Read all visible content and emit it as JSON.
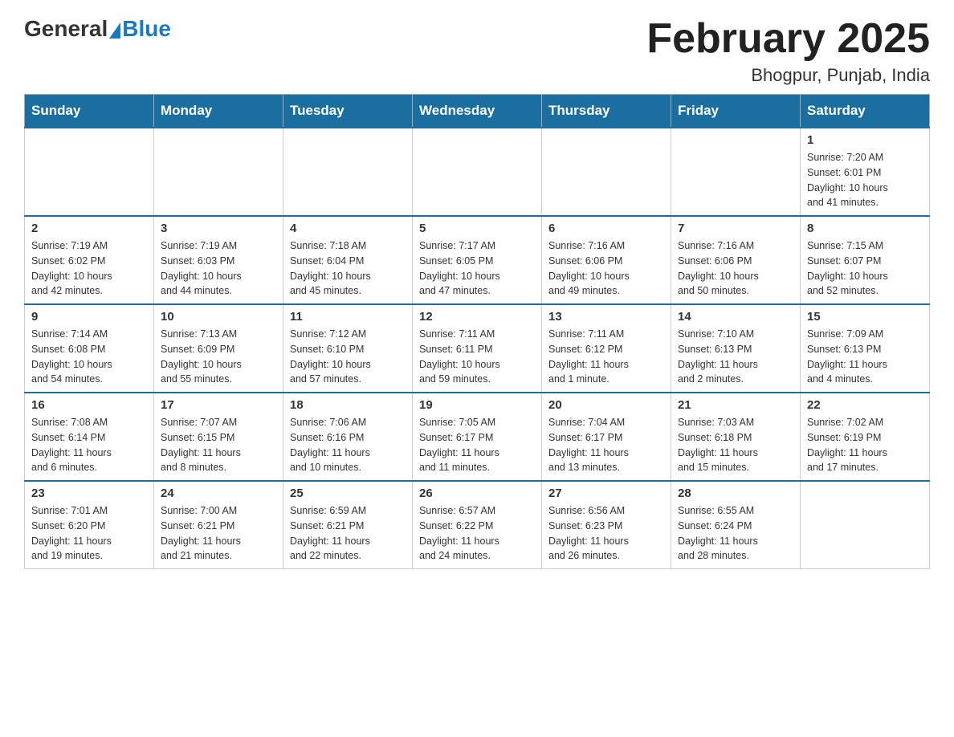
{
  "header": {
    "logo_general": "General",
    "logo_blue": "Blue",
    "month_title": "February 2025",
    "location": "Bhogpur, Punjab, India"
  },
  "weekdays": [
    "Sunday",
    "Monday",
    "Tuesday",
    "Wednesday",
    "Thursday",
    "Friday",
    "Saturday"
  ],
  "weeks": [
    [
      {
        "day": "",
        "info": ""
      },
      {
        "day": "",
        "info": ""
      },
      {
        "day": "",
        "info": ""
      },
      {
        "day": "",
        "info": ""
      },
      {
        "day": "",
        "info": ""
      },
      {
        "day": "",
        "info": ""
      },
      {
        "day": "1",
        "info": "Sunrise: 7:20 AM\nSunset: 6:01 PM\nDaylight: 10 hours\nand 41 minutes."
      }
    ],
    [
      {
        "day": "2",
        "info": "Sunrise: 7:19 AM\nSunset: 6:02 PM\nDaylight: 10 hours\nand 42 minutes."
      },
      {
        "day": "3",
        "info": "Sunrise: 7:19 AM\nSunset: 6:03 PM\nDaylight: 10 hours\nand 44 minutes."
      },
      {
        "day": "4",
        "info": "Sunrise: 7:18 AM\nSunset: 6:04 PM\nDaylight: 10 hours\nand 45 minutes."
      },
      {
        "day": "5",
        "info": "Sunrise: 7:17 AM\nSunset: 6:05 PM\nDaylight: 10 hours\nand 47 minutes."
      },
      {
        "day": "6",
        "info": "Sunrise: 7:16 AM\nSunset: 6:06 PM\nDaylight: 10 hours\nand 49 minutes."
      },
      {
        "day": "7",
        "info": "Sunrise: 7:16 AM\nSunset: 6:06 PM\nDaylight: 10 hours\nand 50 minutes."
      },
      {
        "day": "8",
        "info": "Sunrise: 7:15 AM\nSunset: 6:07 PM\nDaylight: 10 hours\nand 52 minutes."
      }
    ],
    [
      {
        "day": "9",
        "info": "Sunrise: 7:14 AM\nSunset: 6:08 PM\nDaylight: 10 hours\nand 54 minutes."
      },
      {
        "day": "10",
        "info": "Sunrise: 7:13 AM\nSunset: 6:09 PM\nDaylight: 10 hours\nand 55 minutes."
      },
      {
        "day": "11",
        "info": "Sunrise: 7:12 AM\nSunset: 6:10 PM\nDaylight: 10 hours\nand 57 minutes."
      },
      {
        "day": "12",
        "info": "Sunrise: 7:11 AM\nSunset: 6:11 PM\nDaylight: 10 hours\nand 59 minutes."
      },
      {
        "day": "13",
        "info": "Sunrise: 7:11 AM\nSunset: 6:12 PM\nDaylight: 11 hours\nand 1 minute."
      },
      {
        "day": "14",
        "info": "Sunrise: 7:10 AM\nSunset: 6:13 PM\nDaylight: 11 hours\nand 2 minutes."
      },
      {
        "day": "15",
        "info": "Sunrise: 7:09 AM\nSunset: 6:13 PM\nDaylight: 11 hours\nand 4 minutes."
      }
    ],
    [
      {
        "day": "16",
        "info": "Sunrise: 7:08 AM\nSunset: 6:14 PM\nDaylight: 11 hours\nand 6 minutes."
      },
      {
        "day": "17",
        "info": "Sunrise: 7:07 AM\nSunset: 6:15 PM\nDaylight: 11 hours\nand 8 minutes."
      },
      {
        "day": "18",
        "info": "Sunrise: 7:06 AM\nSunset: 6:16 PM\nDaylight: 11 hours\nand 10 minutes."
      },
      {
        "day": "19",
        "info": "Sunrise: 7:05 AM\nSunset: 6:17 PM\nDaylight: 11 hours\nand 11 minutes."
      },
      {
        "day": "20",
        "info": "Sunrise: 7:04 AM\nSunset: 6:17 PM\nDaylight: 11 hours\nand 13 minutes."
      },
      {
        "day": "21",
        "info": "Sunrise: 7:03 AM\nSunset: 6:18 PM\nDaylight: 11 hours\nand 15 minutes."
      },
      {
        "day": "22",
        "info": "Sunrise: 7:02 AM\nSunset: 6:19 PM\nDaylight: 11 hours\nand 17 minutes."
      }
    ],
    [
      {
        "day": "23",
        "info": "Sunrise: 7:01 AM\nSunset: 6:20 PM\nDaylight: 11 hours\nand 19 minutes."
      },
      {
        "day": "24",
        "info": "Sunrise: 7:00 AM\nSunset: 6:21 PM\nDaylight: 11 hours\nand 21 minutes."
      },
      {
        "day": "25",
        "info": "Sunrise: 6:59 AM\nSunset: 6:21 PM\nDaylight: 11 hours\nand 22 minutes."
      },
      {
        "day": "26",
        "info": "Sunrise: 6:57 AM\nSunset: 6:22 PM\nDaylight: 11 hours\nand 24 minutes."
      },
      {
        "day": "27",
        "info": "Sunrise: 6:56 AM\nSunset: 6:23 PM\nDaylight: 11 hours\nand 26 minutes."
      },
      {
        "day": "28",
        "info": "Sunrise: 6:55 AM\nSunset: 6:24 PM\nDaylight: 11 hours\nand 28 minutes."
      },
      {
        "day": "",
        "info": ""
      }
    ]
  ]
}
